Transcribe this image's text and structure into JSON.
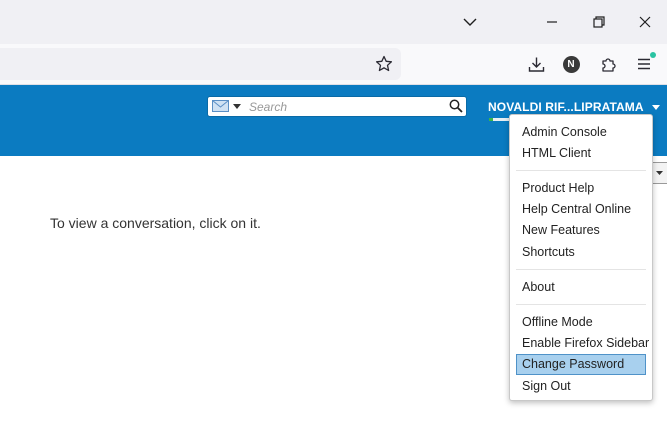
{
  "browser": {
    "window_controls": {
      "list_tabs_icon": "chevron-down-icon",
      "minimize_icon": "minimize-icon",
      "restore_icon": "restore-icon",
      "close_icon": "close-icon"
    },
    "toolbar": {
      "bookmark_icon": "star-icon",
      "downloads_icon": "download-icon",
      "extension_badge": "N",
      "extensions_icon": "puzzle-icon",
      "menu_icon": "hamburger-icon"
    }
  },
  "header": {
    "search": {
      "type_icon": "mail-icon",
      "placeholder": "Search",
      "value": ""
    },
    "user_name": "NOVALDI RIF...LIPRATAMA",
    "presence_color": "#3bb54a"
  },
  "main": {
    "empty_message": "To view a conversation, click on it."
  },
  "user_menu": {
    "groups": [
      [
        {
          "label": "Admin Console"
        },
        {
          "label": "HTML Client"
        }
      ],
      [
        {
          "label": "Product Help"
        },
        {
          "label": "Help Central Online"
        },
        {
          "label": "New Features"
        },
        {
          "label": "Shortcuts"
        }
      ],
      [
        {
          "label": "About"
        }
      ],
      [
        {
          "label": "Offline Mode"
        },
        {
          "label": "Enable Firefox Sidebar"
        },
        {
          "label": "Change Password",
          "highlighted": true
        },
        {
          "label": "Sign Out"
        }
      ]
    ]
  },
  "colors": {
    "header_bg": "#0b7bc1",
    "highlight_bg": "#a8d0ee",
    "highlight_border": "#4f92c8"
  }
}
